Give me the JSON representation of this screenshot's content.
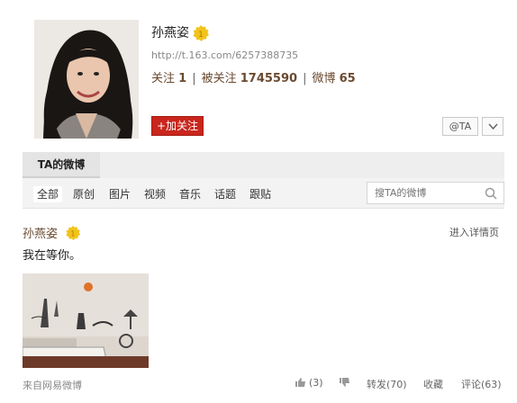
{
  "profile": {
    "name": "孙燕姿",
    "url": "http://t.163.com/6257388735",
    "stats": {
      "following_label": "关注",
      "following_value": "1",
      "followers_label": "被关注",
      "followers_value": "1745590",
      "posts_label": "微博",
      "posts_value": "65"
    },
    "follow_button": "+加关注",
    "at_button": "@TA"
  },
  "tabs": {
    "active": "TA的微博"
  },
  "filters": [
    "全部",
    "原创",
    "图片",
    "视频",
    "音乐",
    "话题",
    "跟贴"
  ],
  "search": {
    "placeholder": "搜TA的微博"
  },
  "post": {
    "author": "孙燕姿",
    "detail_link": "进入详情页",
    "text": "我在等你。",
    "source": "来自网易微博",
    "like_count": "(3)",
    "repost": "转发(70)",
    "favorite": "收藏",
    "comment": "评论(63)"
  },
  "colors": {
    "accent_red": "#c9261d",
    "name_brown": "#6a4a30",
    "badge_gold": "#f2c31b"
  }
}
